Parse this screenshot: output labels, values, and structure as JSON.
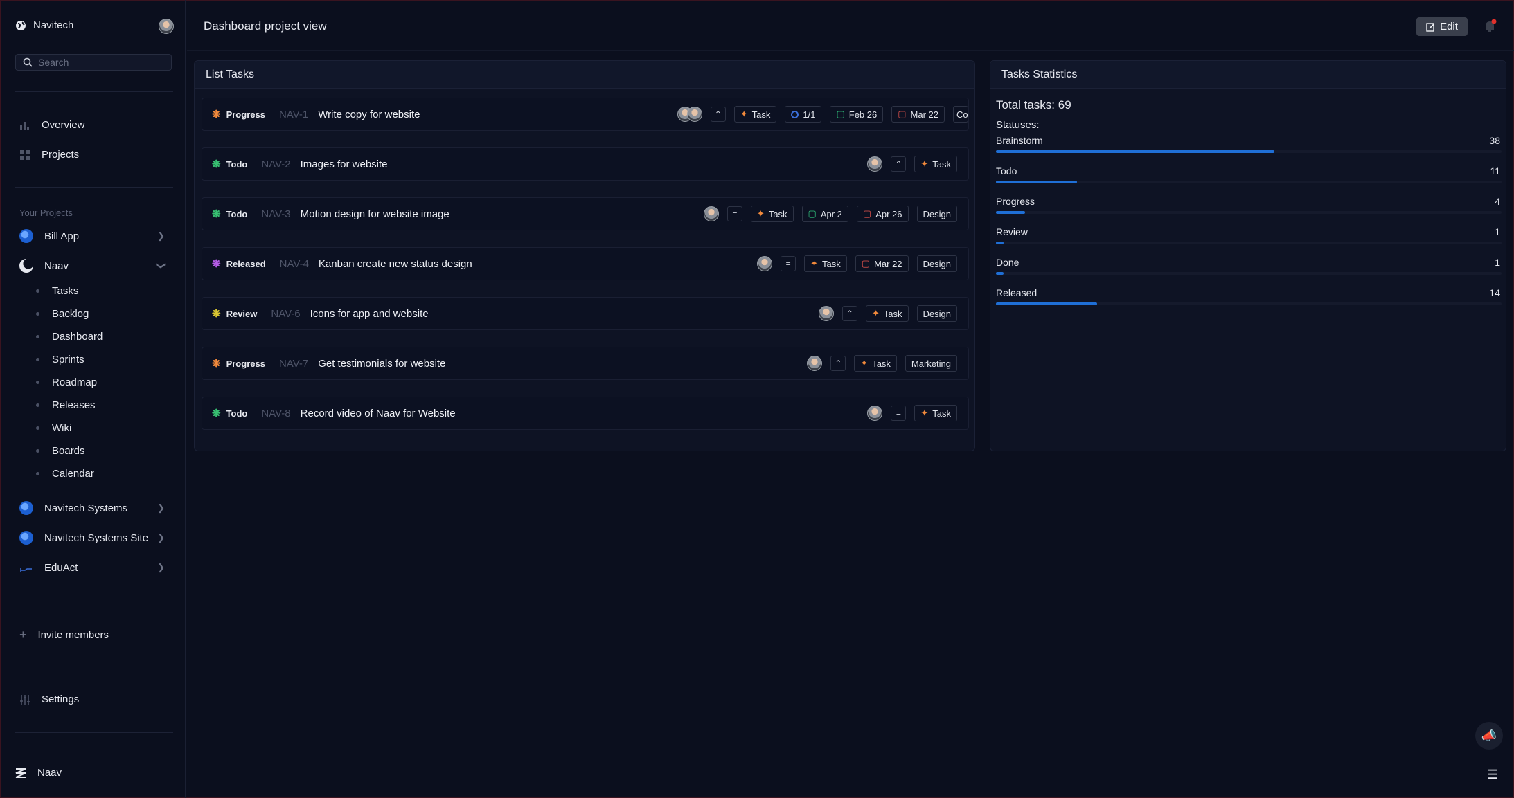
{
  "workspace": {
    "name": "Navitech"
  },
  "search": {
    "placeholder": "Search"
  },
  "nav": {
    "overview": "Overview",
    "projects": "Projects"
  },
  "sidebar": {
    "section_label": "Your Projects",
    "projects": [
      {
        "label": "Bill App",
        "icon": "globe-icon"
      },
      {
        "label": "Naav",
        "icon": "moon-icon"
      },
      {
        "label": "Navitech Systems",
        "icon": "globe-icon"
      },
      {
        "label": "Navitech Systems Site",
        "icon": "globe-icon"
      },
      {
        "label": "EduAct",
        "icon": "graph-icon"
      }
    ],
    "subitems": [
      "Tasks",
      "Backlog",
      "Dashboard",
      "Sprints",
      "Roadmap",
      "Releases",
      "Wiki",
      "Boards",
      "Calendar"
    ],
    "invite": "Invite members",
    "settings": "Settings",
    "bottom_brand": "Naav"
  },
  "header": {
    "title": "Dashboard project view",
    "edit_label": "Edit"
  },
  "list": {
    "title": "List Tasks",
    "tasks": [
      {
        "status": "Progress",
        "id": "NAV-1",
        "title": "Write copy for website",
        "type": "Task",
        "sprint": "1/1",
        "start": "Feb 26",
        "due": "Mar 22",
        "label": "Co"
      },
      {
        "status": "Todo",
        "id": "NAV-2",
        "title": "Images for website",
        "type": "Task"
      },
      {
        "status": "Todo",
        "id": "NAV-3",
        "title": "Motion design for website image",
        "type": "Task",
        "start": "Apr 2",
        "due": "Apr 26",
        "label": "Design"
      },
      {
        "status": "Released",
        "id": "NAV-4",
        "title": "Kanban create new status design",
        "type": "Task",
        "due": "Mar 22",
        "label": "Design"
      },
      {
        "status": "Review",
        "id": "NAV-6",
        "title": "Icons for app and website",
        "type": "Task",
        "label": "Design"
      },
      {
        "status": "Progress",
        "id": "NAV-7",
        "title": "Get testimonials for website",
        "type": "Task",
        "label": "Marketing"
      },
      {
        "status": "Todo",
        "id": "NAV-8",
        "title": "Record video of Naav for Website",
        "type": "Task"
      }
    ]
  },
  "stats": {
    "title": "Tasks Statistics",
    "total": "Total tasks: 69",
    "statuses_label": "Statuses:",
    "items": [
      {
        "name": "Brainstorm",
        "count": "38",
        "fraction": 0.55
      },
      {
        "name": "Todo",
        "count": "11",
        "fraction": 0.16
      },
      {
        "name": "Progress",
        "count": "4",
        "fraction": 0.058
      },
      {
        "name": "Review",
        "count": "1",
        "fraction": 0.015
      },
      {
        "name": "Done",
        "count": "1",
        "fraction": 0.015
      },
      {
        "name": "Released",
        "count": "14",
        "fraction": 0.2
      }
    ]
  },
  "colors": {
    "accent": "#1f6fd6",
    "task_icon": "#f28a3c",
    "progress": "#f28a3c",
    "todo": "#38c172",
    "released": "#b45ce6",
    "review": "#d9c632"
  }
}
